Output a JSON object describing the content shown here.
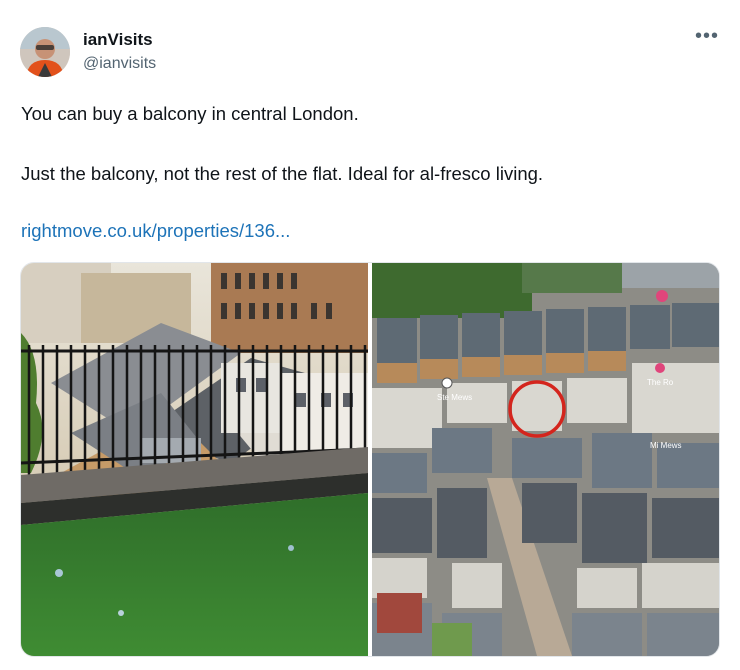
{
  "tweet": {
    "author": {
      "name": "ianVisits",
      "handle": "@ianvisits",
      "avatar_icon": "profile-photo"
    },
    "more_icon": "more-options-icon",
    "more_label": "•••",
    "text": {
      "line1": "You can buy a balcony in central London.",
      "line2": "Just the balcony, not the rest of the flat. Ideal for al-fresco living."
    },
    "link": "rightmove.co.uk/properties/136...",
    "media": {
      "count": 2,
      "photo_left": "balcony-photo",
      "photo_right": "aerial-map-photo",
      "map_labels": [
        "Ste Mews",
        "The Ro",
        "Mi Mews"
      ]
    }
  },
  "colors": {
    "text": "#0f1419",
    "secondary_text": "#536471",
    "link": "#1d73b8",
    "highlight_circle": "#d4251d"
  }
}
